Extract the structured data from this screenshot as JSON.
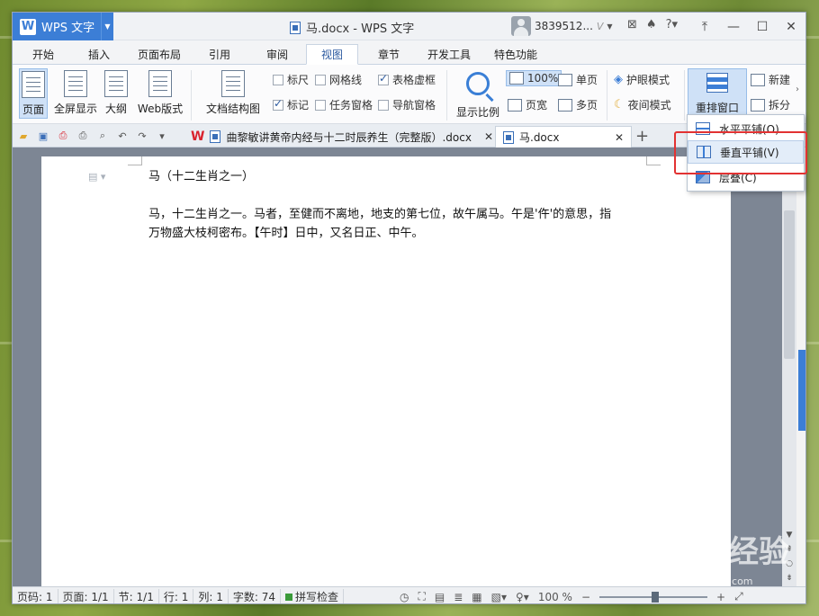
{
  "window": {
    "app_name": "WPS 文字",
    "doc_title": "马.docx - WPS 文字",
    "user": "3839512...",
    "user_badge": "V"
  },
  "menu_tabs": [
    "开始",
    "插入",
    "页面布局",
    "引用",
    "审阅",
    "视图",
    "章节",
    "开发工具",
    "特色功能"
  ],
  "active_tab": "视图",
  "ribbon": {
    "page": "页面",
    "fullscreen": "全屏显示",
    "outline": "大纲",
    "web_layout": "Web版式",
    "doc_structure": "文档结构图",
    "ruler": "标尺",
    "gridlines": "网格线",
    "table_gridlines": "表格虚框",
    "markup": "标记",
    "task_pane": "任务窗格",
    "nav_pane": "导航窗格",
    "zoom_ratio": "显示比例",
    "zoom_100": "100%",
    "page_width": "页宽",
    "single_page": "单页",
    "multi_page": "多页",
    "eye_mode": "护眼模式",
    "night_mode": "夜间模式",
    "rearrange": "重排窗口",
    "new_window": "新建",
    "split": "拆分"
  },
  "doc_tabs": [
    {
      "label": "曲黎敏讲黄帝内经与十二时辰养生（完整版）.docx"
    },
    {
      "label": "马.docx"
    }
  ],
  "document": {
    "title": "马（十二生肖之一）",
    "body_line1": "马，十二生肖之一。马者，至健而不离地，地支的第七位，故午属马。午是'仵'的意思，指",
    "body_line2": "万物盛大枝柯密布。【午时】日中，又名日正、中午。"
  },
  "dropdown": {
    "horizontal": "水平平铺(O)",
    "vertical": "垂直平铺(V)",
    "cascade": "层叠(C)"
  },
  "status": {
    "page_no": "页码: 1",
    "pages": "页面: 1/1",
    "section": "节: 1/1",
    "row": "行: 1",
    "col": "列: 1",
    "words": "字数: 74",
    "spell": "拼写检查",
    "zoom": "100 %"
  },
  "watermark": {
    "text": "Baidu经验",
    "url": "jingyan.baidu.com"
  }
}
